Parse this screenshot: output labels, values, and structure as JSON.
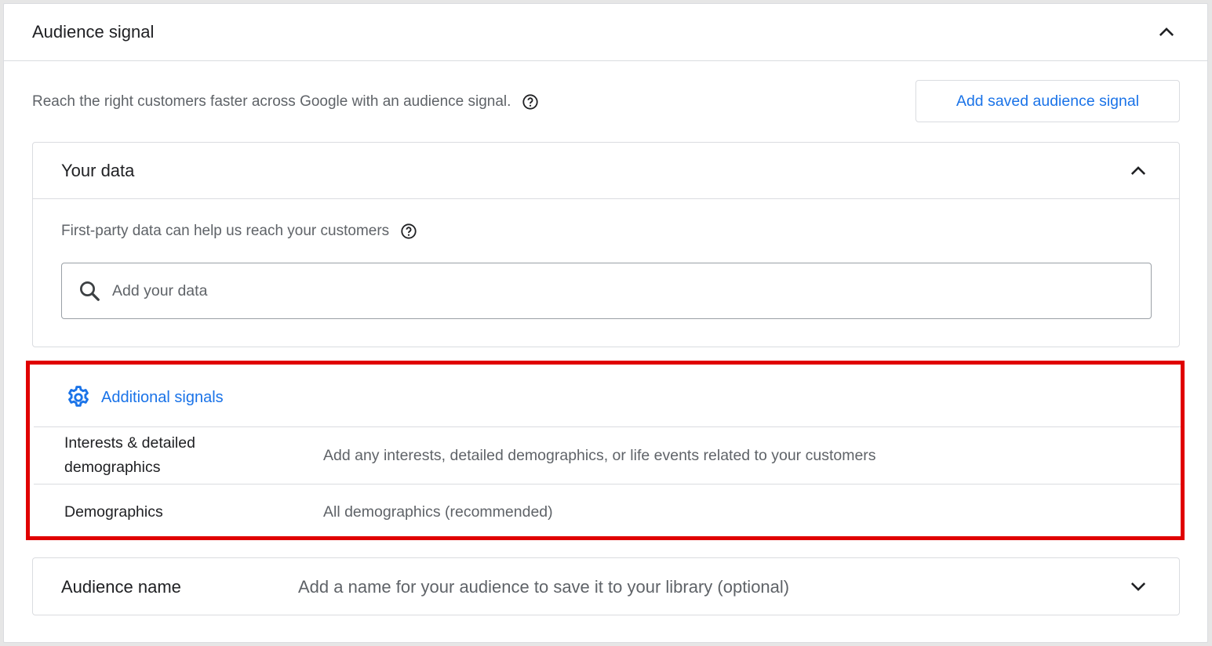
{
  "card": {
    "title": "Audience signal",
    "intro": "Reach the right customers faster across Google with an audience signal.",
    "saved_button": "Add saved audience signal"
  },
  "your_data": {
    "title": "Your data",
    "description": "First-party data can help us reach your customers",
    "search_placeholder": "Add your data"
  },
  "additional_signals": {
    "title": "Additional signals",
    "rows": [
      {
        "label": "Interests & detailed demographics",
        "value": "Add any interests, detailed demographics, or life events related to your customers"
      },
      {
        "label": "Demographics",
        "value": "All demographics (recommended)"
      }
    ]
  },
  "audience_name": {
    "title": "Audience name",
    "hint": "Add a name for your audience to save it to your library (optional)"
  },
  "icons": {
    "collapse": "chevron-up-icon",
    "expand": "chevron-down-icon",
    "help": "help-icon",
    "search": "search-icon",
    "settings": "gear-icon"
  },
  "colors": {
    "accent": "#1a73e8",
    "highlight": "#e00000",
    "border": "#dadce0",
    "secondary_text": "#5f6368"
  }
}
